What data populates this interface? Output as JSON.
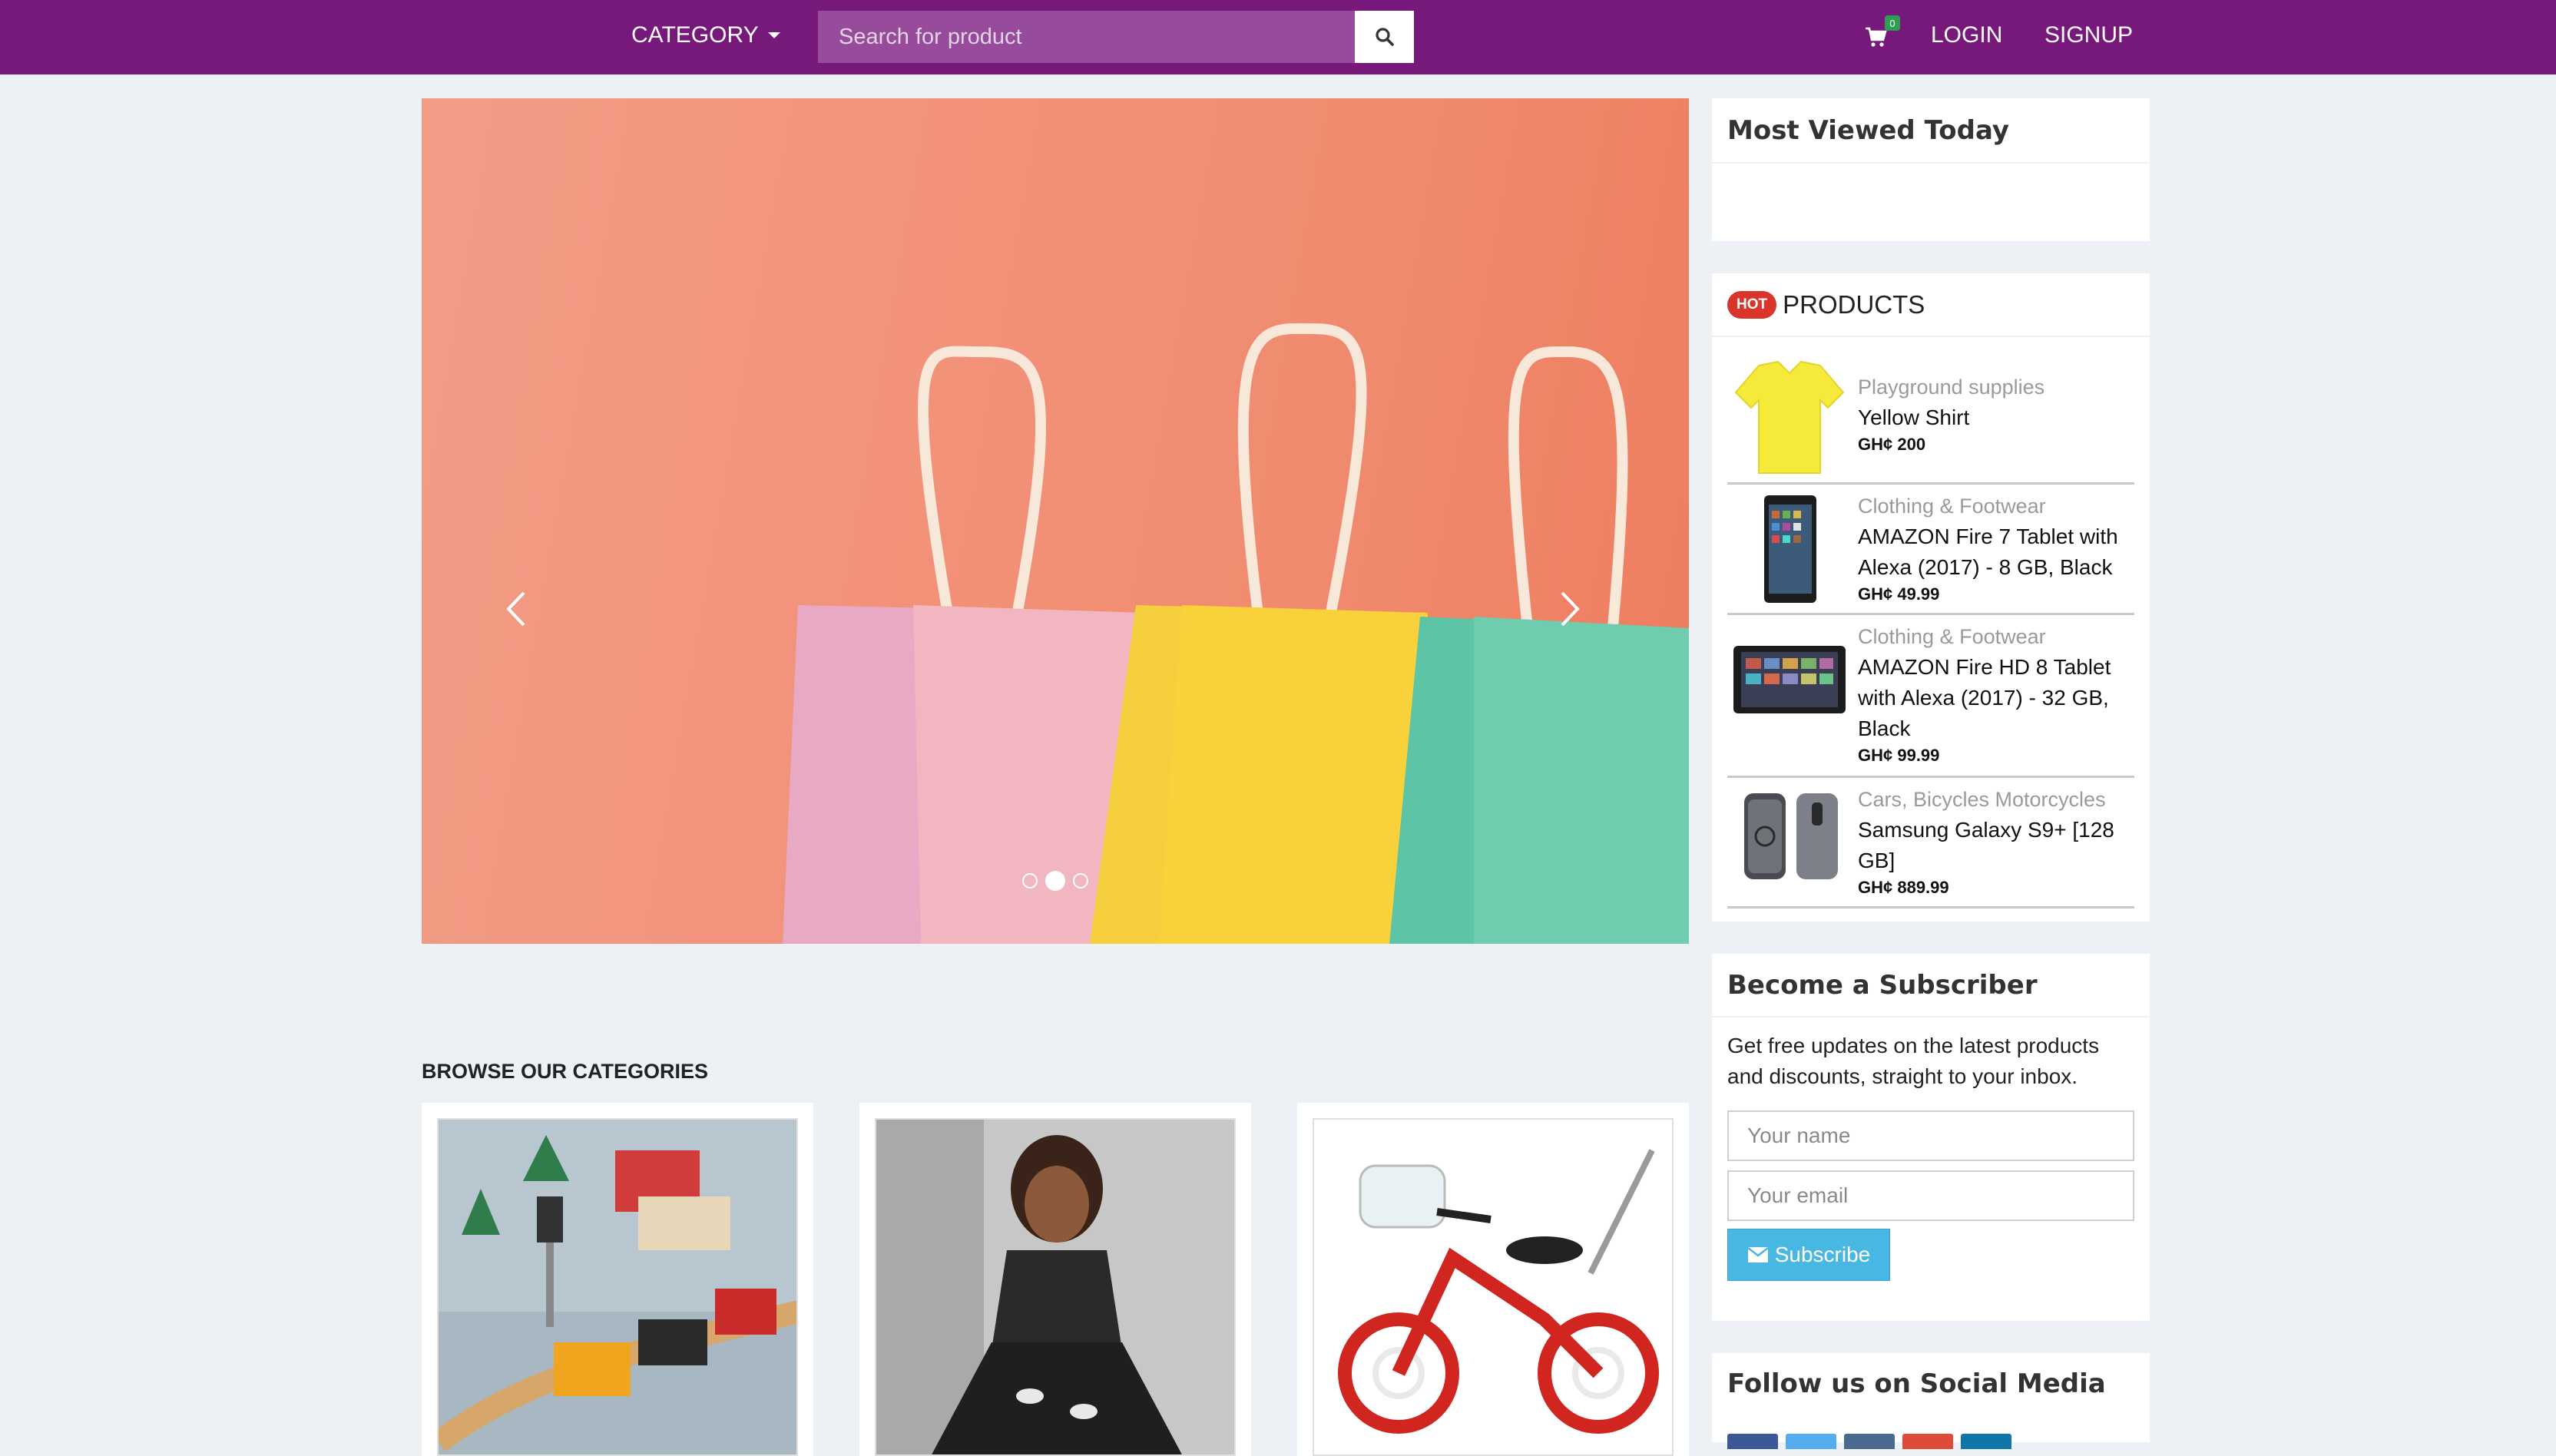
{
  "navbar": {
    "category_label": "CATEGORY",
    "search_placeholder": "Search for product",
    "cart_count": "0",
    "login_label": "LOGIN",
    "signup_label": "SIGNUP",
    "bg_color": "#77197b"
  },
  "carousel": {
    "slide_count": 3,
    "active_slide": 2
  },
  "categories": {
    "title": "BROWSE OUR CATEGORIES"
  },
  "sidebar": {
    "most_viewed_title": "Most Viewed Today",
    "hot_badge": "HOT",
    "products_title": "PRODUCTS",
    "products": [
      {
        "category": "Playground supplies",
        "name": "Yellow Shirt",
        "price": "GH¢ 200",
        "icon": "yellow-shirt-image"
      },
      {
        "category": "Clothing & Footwear",
        "name": "AMAZON Fire 7 Tablet with Alexa (2017) - 8 GB, Black",
        "price": "GH¢ 49.99",
        "icon": "tablet-image"
      },
      {
        "category": "Clothing & Footwear",
        "name": "AMAZON Fire HD 8 Tablet with Alexa (2017) - 32 GB, Black",
        "price": "GH¢ 99.99",
        "icon": "tablet-landscape-image"
      },
      {
        "category": "Cars, Bicycles Motorcycles",
        "name": "Samsung Galaxy S9+ [128 GB]",
        "price": "GH¢ 889.99",
        "icon": "phone-image"
      }
    ],
    "subscribe": {
      "title": "Become a Subscriber",
      "description": "Get free updates on the latest products and discounts, straight to your inbox.",
      "name_placeholder": "Your name",
      "email_placeholder": "Your email",
      "button_label": "Subscribe"
    },
    "social_title": "Follow us on Social Media",
    "social_colors": [
      "#3b5998",
      "#55acee",
      "#4b6a8f",
      "#dd4b39",
      "#0e76a8"
    ]
  }
}
